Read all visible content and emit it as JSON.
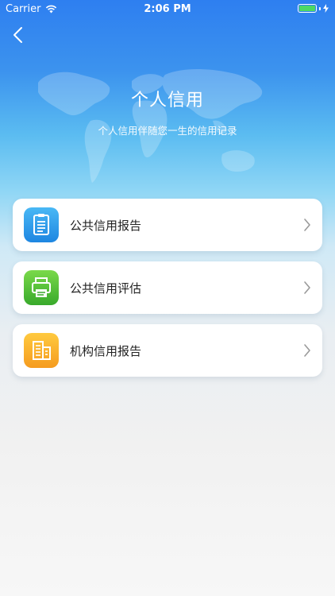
{
  "status_bar": {
    "carrier": "Carrier",
    "time": "2:06 PM"
  },
  "header": {
    "title": "个人信用",
    "subtitle": "个人信用伴随您一生的信用记录"
  },
  "menu": {
    "items": [
      {
        "label": "公共信用报告",
        "icon": "clipboard-icon",
        "color_top": "#49b8f5",
        "color_bottom": "#1e86e1"
      },
      {
        "label": "公共信用评估",
        "icon": "printer-icon",
        "color_top": "#7ad94a",
        "color_bottom": "#38a92b"
      },
      {
        "label": "机构信用报告",
        "icon": "building-icon",
        "color_top": "#ffca3f",
        "color_bottom": "#f59b1f"
      }
    ]
  }
}
